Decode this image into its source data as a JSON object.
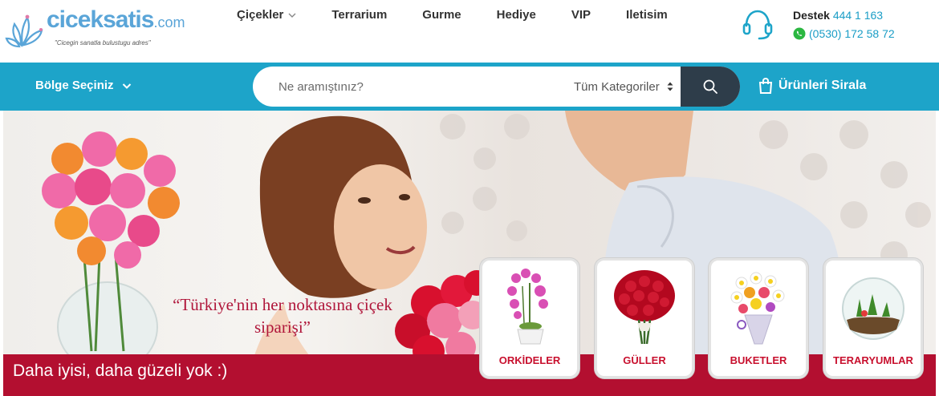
{
  "header": {
    "logo": {
      "text_main": "ciceksatis",
      "text_suffix": ".com",
      "tagline": "\"Cicegin sanatla bulustugu adres\""
    },
    "nav": [
      {
        "label": "Çiçekler",
        "has_dropdown": true
      },
      {
        "label": "Terrarium"
      },
      {
        "label": "Gurme"
      },
      {
        "label": "Hediye"
      },
      {
        "label": "VIP"
      },
      {
        "label": "Iletisim"
      }
    ],
    "support": {
      "label": "Destek",
      "phone": "444 1 163",
      "whatsapp": "(0530) 172 58 72"
    }
  },
  "bar": {
    "region_label": "Bölge Seçiniz",
    "search_placeholder": "Ne aramıştınız?",
    "category_label": "Tüm Kategoriler",
    "sort_label": "Ürünleri Sirala"
  },
  "hero": {
    "quote": "“Türkiye'nin her noktasına çiçek siparişi”",
    "strip_text": "Daha iyisi, daha güzeli yok :)",
    "categories": [
      {
        "label": "ORKİDELER",
        "icon": "orchid-icon"
      },
      {
        "label": "GÜLLER",
        "icon": "roses-icon"
      },
      {
        "label": "BUKETLER",
        "icon": "bouquet-icon"
      },
      {
        "label": "TERARYUMLAR",
        "icon": "terrarium-icon"
      }
    ]
  },
  "colors": {
    "brand_blue": "#1da4c9",
    "search_button": "#2e3d4a",
    "accent_red": "#b30f30",
    "logo_blue": "#5aa5d8"
  }
}
